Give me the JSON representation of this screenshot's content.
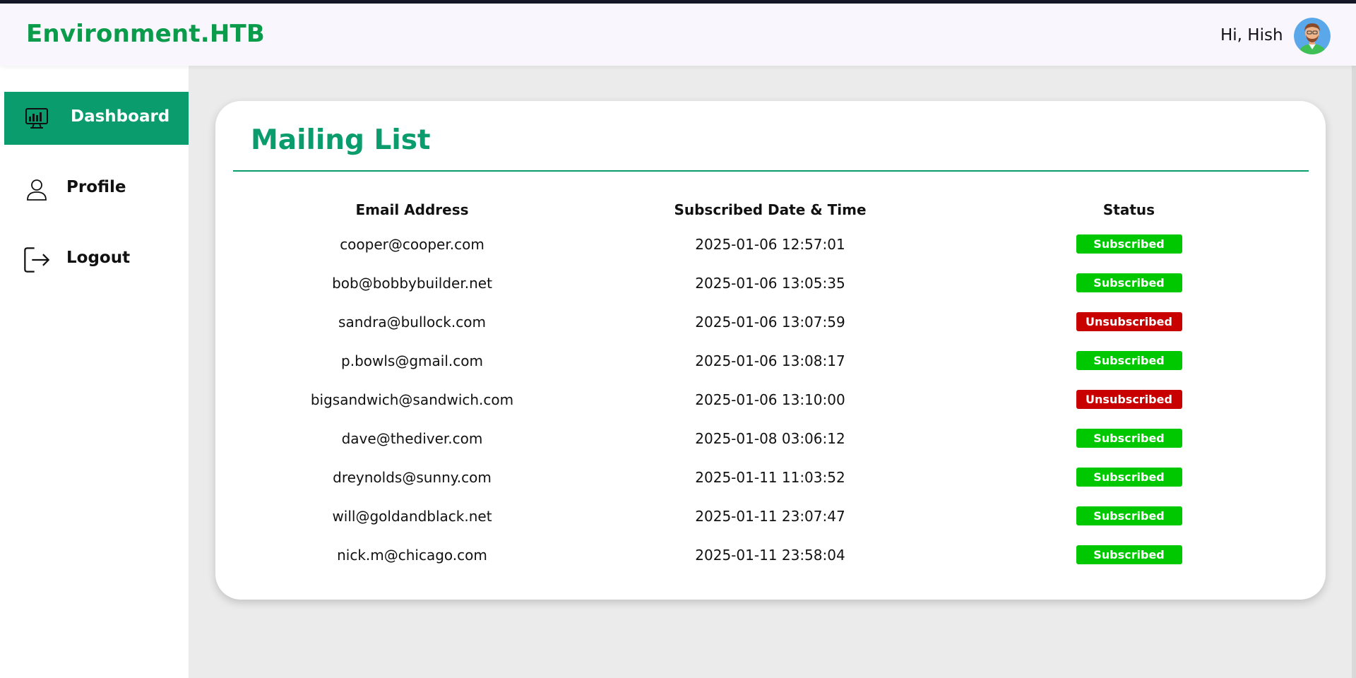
{
  "header": {
    "brand": "Environment.HTB",
    "greeting": "Hi, Hish"
  },
  "sidebar": {
    "items": [
      {
        "label": "Dashboard",
        "icon": "monitor-chart-icon",
        "active": true
      },
      {
        "label": "Profile",
        "icon": "user-icon",
        "active": false
      },
      {
        "label": "Logout",
        "icon": "logout-icon",
        "active": false
      }
    ]
  },
  "card": {
    "title": "Mailing List",
    "columns": [
      "Email Address",
      "Subscribed Date & Time",
      "Status"
    ],
    "rows": [
      {
        "email": "cooper@cooper.com",
        "datetime": "2025-01-06 12:57:01",
        "status": "Subscribed"
      },
      {
        "email": "bob@bobbybuilder.net",
        "datetime": "2025-01-06 13:05:35",
        "status": "Subscribed"
      },
      {
        "email": "sandra@bullock.com",
        "datetime": "2025-01-06 13:07:59",
        "status": "Unsubscribed"
      },
      {
        "email": "p.bowls@gmail.com",
        "datetime": "2025-01-06 13:08:17",
        "status": "Subscribed"
      },
      {
        "email": "bigsandwich@sandwich.com",
        "datetime": "2025-01-06 13:10:00",
        "status": "Unsubscribed"
      },
      {
        "email": "dave@thediver.com",
        "datetime": "2025-01-08 03:06:12",
        "status": "Subscribed"
      },
      {
        "email": "dreynolds@sunny.com",
        "datetime": "2025-01-11 11:03:52",
        "status": "Subscribed"
      },
      {
        "email": "will@goldandblack.net",
        "datetime": "2025-01-11 23:07:47",
        "status": "Subscribed"
      },
      {
        "email": "nick.m@chicago.com",
        "datetime": "2025-01-11 23:58:04",
        "status": "Subscribed"
      }
    ]
  },
  "colors": {
    "brand": "#0a9c4a",
    "accent": "#0a9c6c",
    "subscribed": "#00c800",
    "unsubscribed": "#c80000"
  }
}
